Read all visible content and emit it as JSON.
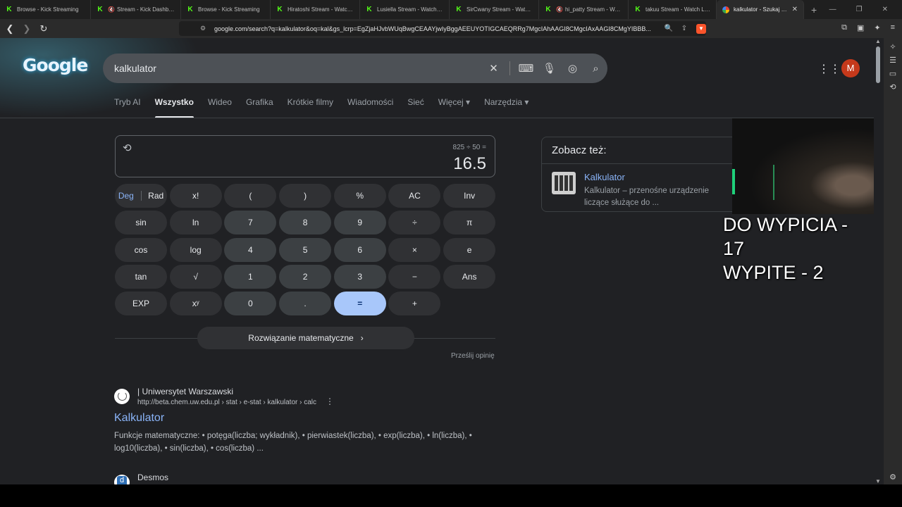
{
  "tabs": [
    {
      "title": "Browse - Kick Streaming",
      "muted": false,
      "favicon": "kick-icon"
    },
    {
      "title": "Stream - Kick Dashboard",
      "muted": true,
      "favicon": "kick-icon"
    },
    {
      "title": "Browse - Kick Streaming",
      "muted": false,
      "favicon": "kick-icon"
    },
    {
      "title": "Hiratoshi Stream - Watch Live",
      "muted": false,
      "favicon": "kick-icon"
    },
    {
      "title": "Lusiella Stream - Watch Live",
      "muted": false,
      "favicon": "kick-icon"
    },
    {
      "title": "SirCwany Stream - Watch Live",
      "muted": false,
      "favicon": "kick-icon"
    },
    {
      "title": "hi_patty Stream - Watch Live",
      "muted": true,
      "favicon": "kick-icon"
    },
    {
      "title": "takuu Stream - Watch Live",
      "muted": false,
      "favicon": "kick-icon"
    },
    {
      "title": "kalkulator - Szukaj w Google",
      "muted": false,
      "favicon": "google-icon",
      "active": true
    }
  ],
  "address": {
    "url": "google.com/search?q=kalkulator&oq=kal&gs_lcrp=EgZjaHJvbWUqBwgCEAAYjwIyBggAEEUYOTIGCAEQRRg7MgcIAhAAGI8CMgcIAxAAGI8CMgYIBBB..."
  },
  "google": {
    "logo": "Google",
    "query": "kalkulator",
    "avatar_letter": "M",
    "nav_tabs": [
      "Tryb AI",
      "Wszystko",
      "Wideo",
      "Grafika",
      "Krótkie filmy",
      "Wiadomości",
      "Sieć",
      "Więcej ▾",
      "Narzędzia ▾"
    ],
    "active_tab": "Wszystko"
  },
  "calculator": {
    "expression": "825 ÷ 50 =",
    "result": "16.5",
    "deg_label": "Deg",
    "rad_label": "Rad",
    "keys": [
      [
        "DEG/RAD",
        "x!",
        "(",
        ")",
        "%",
        "AC"
      ],
      [
        "Inv",
        "sin",
        "ln",
        "7",
        "8",
        "9",
        "÷"
      ],
      [
        "π",
        "cos",
        "log",
        "4",
        "5",
        "6",
        "×"
      ],
      [
        "e",
        "tan",
        "√",
        "1",
        "2",
        "3",
        "−"
      ],
      [
        "Ans",
        "EXP",
        "xʸ",
        "0",
        ".",
        "=",
        "+"
      ]
    ],
    "solve_label": "Rozwiązanie matematyczne",
    "feedback_label": "Prześlij opinię"
  },
  "results": [
    {
      "site": "| Uniwersytet Warszawski",
      "url": "http://beta.chem.uw.edu.pl › stat › e-stat › kalkulator › calc",
      "title": "Kalkulator",
      "snippet": "Funkcje matematyczne: • potęga(liczba; wykładnik), • pierwiastek(liczba), • exp(liczba), • ln(liczba), • log10(liczba), • sin(liczba), • cos(liczba) ..."
    },
    {
      "site": "Desmos"
    }
  ],
  "see_also": {
    "heading": "Zobacz też:",
    "title": "Kalkulator",
    "desc": "Kalkulator – przenośne urządzenie liczące służące do ..."
  },
  "overlay": {
    "line1": "DO WYPICIA - 17",
    "line2": "WYPITE - 2"
  },
  "colors": {
    "page_bg": "#202124",
    "link": "#8ab4f8",
    "equals_key": "#a8c7fa",
    "avatar": "#c5391b",
    "kick_green": "#53fc18"
  }
}
